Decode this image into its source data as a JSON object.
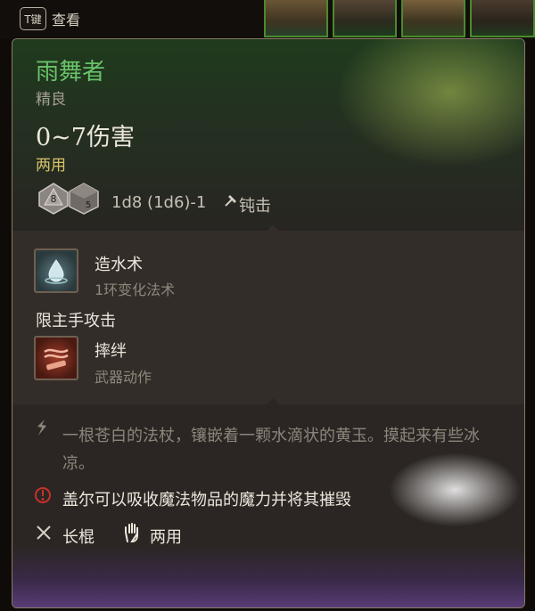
{
  "topbar": {
    "key_cap": "T键",
    "key_action": "查看"
  },
  "tooltip": {
    "item_name": "雨舞者",
    "rarity": "精良",
    "damage": "0~7伤害",
    "handedness": "两用",
    "dice_labels": [
      "8",
      "5"
    ],
    "dice_formula": "1d8 (1d6)-1",
    "damage_type": "钝击",
    "spells": [
      {
        "name": "造水术",
        "subtitle": "1环变化法术",
        "icon": "water-drop-icon"
      },
      {
        "name": "摔绊",
        "subtitle": "武器动作",
        "icon": "trip-attack-icon"
      }
    ],
    "restriction": "限主手攻击",
    "lore": "一根苍白的法杖，镶嵌着一颗水滴状的黄玉。摸起来有些冰凉。",
    "passive": "盖尔可以吸收魔法物品的魔力并将其摧毁",
    "weapon_type": "长棍",
    "hands": "两用"
  },
  "colors": {
    "title_green": "#69c26a",
    "rarity_gray": "#a59e92",
    "handedness_gold": "#d9c46a",
    "passive_red": "#c8322a"
  }
}
